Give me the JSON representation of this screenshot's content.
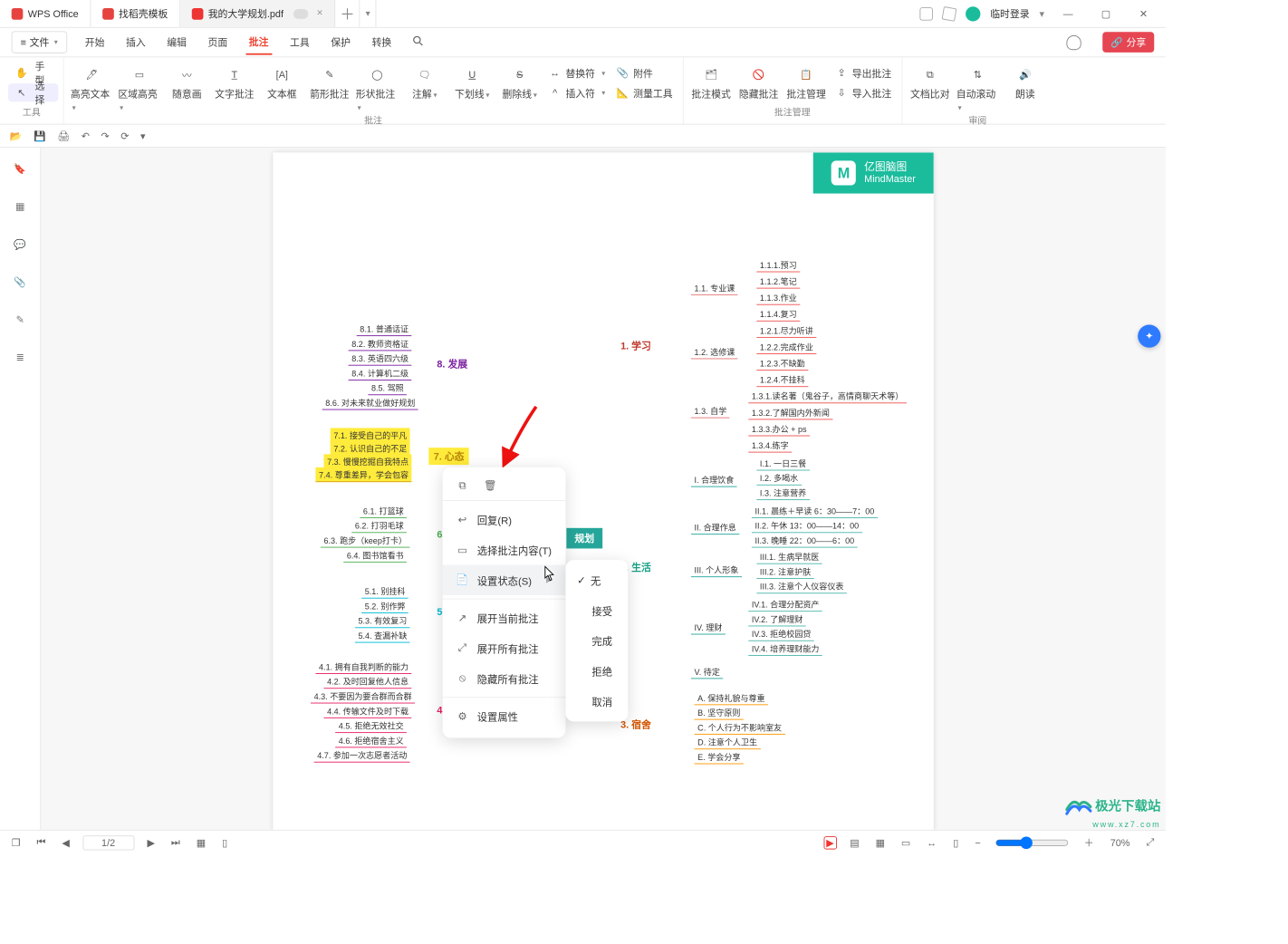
{
  "titlebar": {
    "app_tab": "WPS Office",
    "tab1": "找稻壳模板",
    "tab2": "我的大学规划.pdf",
    "login": "临时登录"
  },
  "menubar": {
    "file": "文件",
    "tabs": [
      "开始",
      "插入",
      "编辑",
      "页面",
      "批注",
      "工具",
      "保护",
      "转换"
    ],
    "active": 4,
    "share": "分享"
  },
  "ribbon": {
    "tool_group": {
      "label": "工具",
      "hand": "手型",
      "select": "选择"
    },
    "annot_group": {
      "label": "批注",
      "highlight": "高亮文本",
      "area": "区域高亮",
      "scribble": "随意画",
      "textannot": "文字批注",
      "textbox": "文本框",
      "shapea": "箭形批注",
      "shape": "形状批注",
      "note": "注解",
      "underline": "下划线",
      "strike": "删除线",
      "replace": "替换符",
      "insert": "插入符",
      "attach": "附件",
      "measure": "测量工具"
    },
    "manage_group": {
      "label": "批注管理",
      "mode": "批注模式",
      "hide": "隐藏批注",
      "mgr": "批注管理",
      "export": "导出批注",
      "import": "导入批注"
    },
    "review_group": {
      "label": "审阅",
      "compare": "文档比对",
      "autoscroll": "自动滚动",
      "read": "朗读"
    }
  },
  "sidebar": {
    "items": [
      "bookmark",
      "thumbnails",
      "comments",
      "attachments",
      "signature",
      "layers"
    ]
  },
  "statusbar": {
    "page": "1/2",
    "zoom": "70%"
  },
  "page": {
    "brand_cn": "亿图脑图",
    "brand_en": "MindMaster",
    "center": "规划",
    "heads": {
      "h1": "1. 学习",
      "h2": "2. 生活",
      "h3": "3. 宿舍",
      "h4": "4. 社交",
      "h5": "5. 考",
      "h6": "6. 娱",
      "h7": "7. 心态",
      "h8": "8. 发展"
    },
    "nodes": {
      "s1_1": "1.1. 专业课",
      "s1_2": "1.2. 选修课",
      "s1_3": "1.3. 自学",
      "s1_1_1": "1.1.1.预习",
      "s1_1_2": "1.1.2.笔记",
      "s1_1_3": "1.1.3.作业",
      "s1_1_4": "1.1.4.复习",
      "s1_2_1": "1.2.1.尽力听讲",
      "s1_2_2": "1.2.2.完成作业",
      "s1_2_3": "1.2.3.不缺勤",
      "s1_2_4": "1.2.4.不挂科",
      "s1_3_1": "1.3.1.读名著（鬼谷子，高情商聊天术等）",
      "s1_3_2": "1.3.2.了解国内外新闻",
      "s1_3_3": "1.3.3.办公 + ps",
      "s1_3_4": "1.3.4.练字",
      "s2_1": "I. 合理饮食",
      "s2_2": "II. 合理作息",
      "s2_3": "III. 个人形象",
      "s2_4": "IV. 理财",
      "s2_5": "V. 待定",
      "s2_1_1": "I.1. 一日三餐",
      "s2_1_2": "I.2. 多喝水",
      "s2_1_3": "I.3. 注意营养",
      "s2_2_1": "II.1. 晨练＋早读 6：30——7：00",
      "s2_2_2": "II.2. 午休 13：00——14：00",
      "s2_2_3": "II.3. 晚睡 22：00——6：00",
      "s2_3_1": "III.1. 生病早就医",
      "s2_3_2": "III.2. 注意护肤",
      "s2_3_3": "III.3. 注意个人仪容仪表",
      "s2_4_1": "IV.1. 合理分配资产",
      "s2_4_2": "IV.2. 了解理财",
      "s2_4_3": "IV.3. 拒绝校园贷",
      "s2_4_4": "IV.4. 培养理财能力",
      "s3_a": "A. 保持礼貌与尊重",
      "s3_b": "B. 坚守原则",
      "s3_c": "C. 个人行为不影响室友",
      "s3_d": "D. 注意个人卫生",
      "s3_e": "E. 学会分享",
      "s4_1": "4.1. 拥有自我判断的能力",
      "s4_2": "4.2. 及时回复他人信息",
      "s4_3": "4.3. 不要因为要合群而合群",
      "s4_4": "4.4. 传输文件及时下载",
      "s4_5": "4.5. 拒绝无效社交",
      "s4_6": "4.6. 拒绝宿舍主义",
      "s4_7": "4.7. 参加一次志愿者活动",
      "s5_1": "5.1. 别挂科",
      "s5_2": "5.2. 别作弊",
      "s5_3": "5.3. 有效复习",
      "s5_4": "5.4. 查漏补缺",
      "s6_1": "6.1. 打篮球",
      "s6_2": "6.2. 打羽毛球",
      "s6_3": "6.3. 跑步（keep打卡）",
      "s6_4": "6.4. 图书馆看书",
      "s7_1": "7.1. 接受自己的平凡",
      "s7_2": "7.2. 认识自己的不足",
      "s7_3": "7.3. 慢慢挖掘自我特点",
      "s7_4": "7.4. 尊重差异，学会包容",
      "s8_1": "8.1. 普通话证",
      "s8_2": "8.2. 教师资格证",
      "s8_3": "8.3. 英语四六级",
      "s8_4": "8.4. 计算机二级",
      "s8_5": "8.5. 驾照",
      "s8_6": "8.6. 对未来就业做好规划"
    }
  },
  "context_menu": {
    "reply": "回复(R)",
    "select_annot": "选择批注内容(T)",
    "set_status": "设置状态(S)",
    "expand_current": "展开当前批注",
    "expand_all": "展开所有批注",
    "hide_all": "隐藏所有批注",
    "properties": "设置属性",
    "sub": {
      "none": "无",
      "accept": "接受",
      "done": "完成",
      "reject": "拒绝",
      "cancel": "取消"
    }
  },
  "watermark": {
    "brand": "极光下载站",
    "url": "www.xz7.com"
  }
}
